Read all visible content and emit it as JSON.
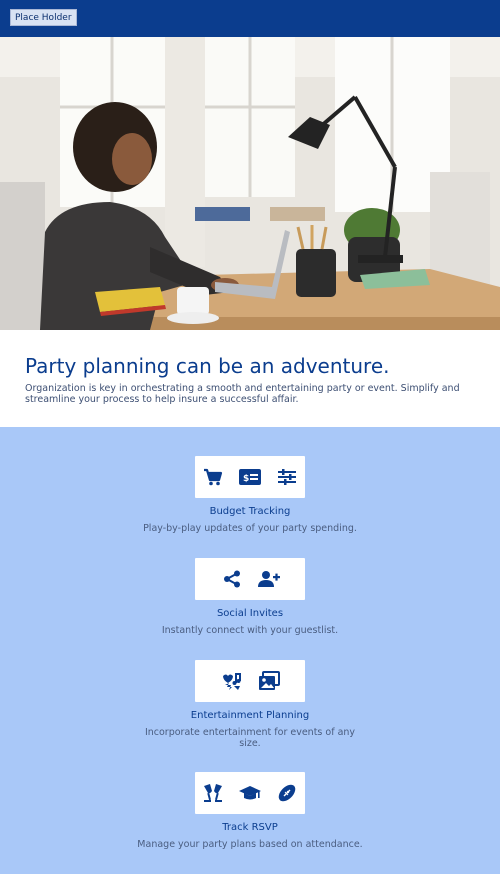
{
  "header": {
    "button_label": "Place Holder"
  },
  "intro": {
    "title": "Party planning can be an adventure.",
    "body": "Organization is key in orchestrating a smooth and entertaining party or event. Simplify and streamline your process to help insure a successful affair."
  },
  "features": [
    {
      "title": "Budget Tracking",
      "description": "Play-by-play updates of your party spending.",
      "icons": [
        "shopping-cart-icon",
        "money-bill-icon",
        "sliders-icon"
      ]
    },
    {
      "title": "Social Invites",
      "description": "Instantly connect with your guestlist.",
      "icons": [
        "share-icon",
        "user-plus-icon"
      ]
    },
    {
      "title": "Entertainment Planning",
      "description": "Incorporate entertainment for events of any size.",
      "icons": [
        "theater-music-icon",
        "photo-gallery-icon"
      ]
    },
    {
      "title": "Track RSVP",
      "description": "Manage your party plans based on attendance.",
      "icons": [
        "glass-cheers-icon",
        "graduation-cap-icon",
        "football-icon"
      ]
    }
  ],
  "colors": {
    "header": "#0b3d8e",
    "accent": "#0b3d8e",
    "features_bg": "#a9c8f8"
  }
}
